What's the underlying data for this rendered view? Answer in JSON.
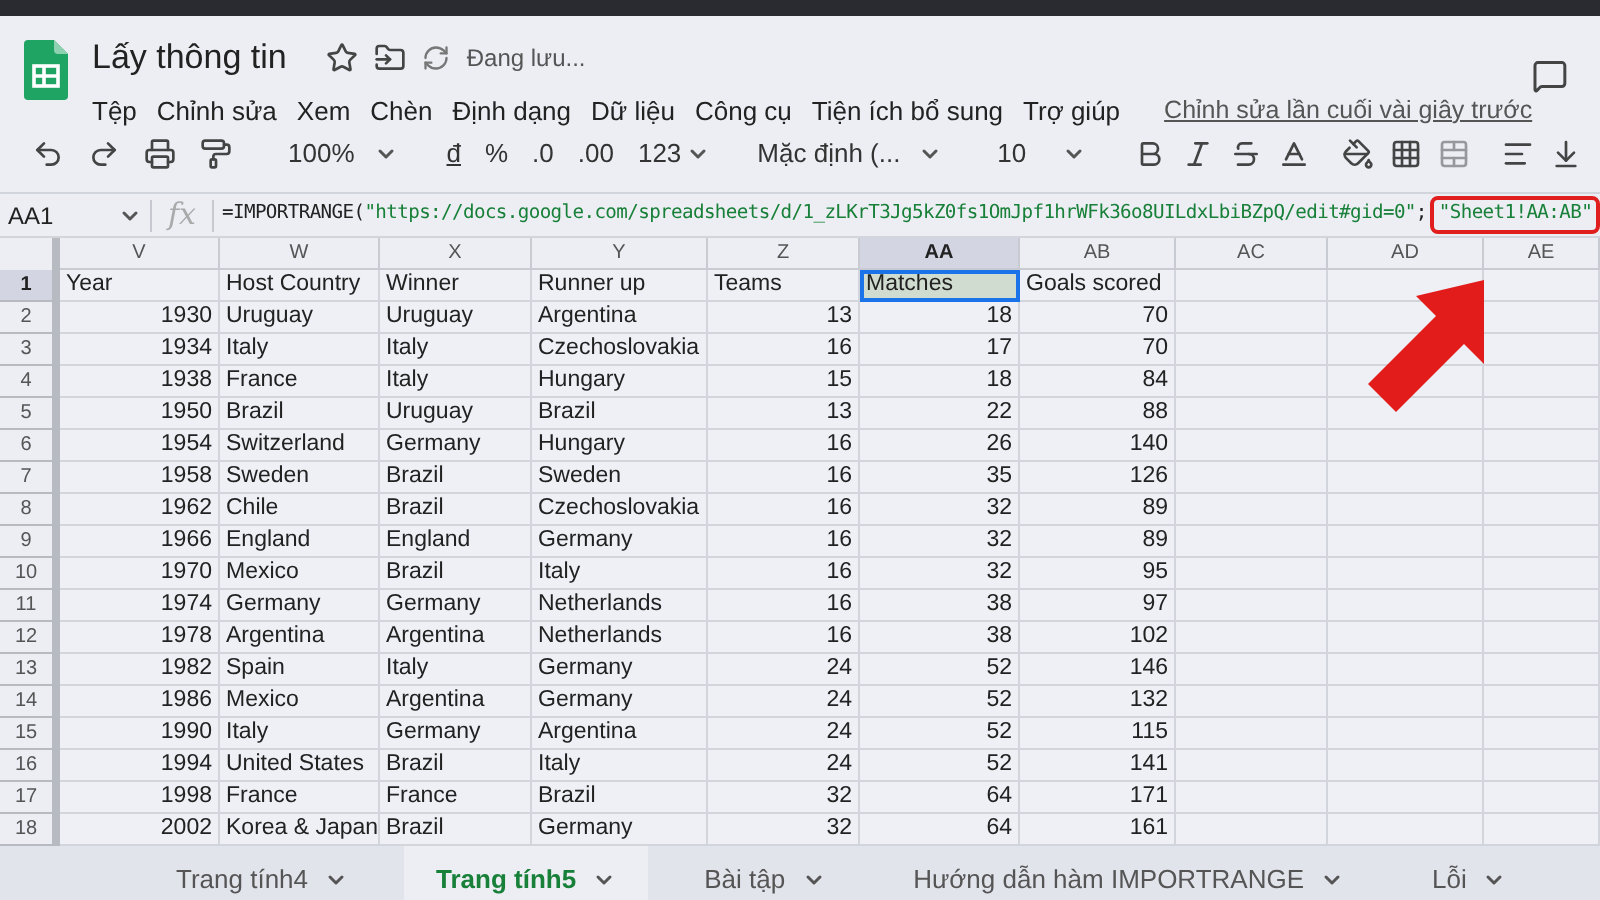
{
  "app": {
    "title": "Lấy thông tin",
    "status": "Đang lưu...",
    "menu": [
      "Tệp",
      "Chỉnh sửa",
      "Xem",
      "Chèn",
      "Định dạng",
      "Dữ liệu",
      "Công cụ",
      "Tiện ích bổ sung",
      "Trợ giúp"
    ],
    "last_edit": "Chỉnh sửa lần cuối vài giây trước"
  },
  "toolbar": {
    "zoom": "100%",
    "currency": "đ",
    "percent": "%",
    "decimal_less": ".0",
    "decimal_more": ".00",
    "number_format": "123",
    "font": "Mặc định (...",
    "font_size": "10"
  },
  "formula_bar": {
    "cell_ref": "AA1",
    "fx": "fx",
    "function": "=IMPORTRANGE(",
    "url": "\"https://docs.google.com/spreadsheets/d/1_zLKrT3Jg5kZ0fs1OmJpf1hrWFk36o8UILdxLbiBZpQ/edit#gid=0\"",
    "separator": ";",
    "range": "\"Sheet1!AA:AB\"",
    "range_highlighted": true
  },
  "columns": [
    {
      "label": "V",
      "selected": false
    },
    {
      "label": "W",
      "selected": false
    },
    {
      "label": "X",
      "selected": false
    },
    {
      "label": "Y",
      "selected": false
    },
    {
      "label": "Z",
      "selected": false
    },
    {
      "label": "AA",
      "selected": true
    },
    {
      "label": "AB",
      "selected": false
    },
    {
      "label": "AC",
      "selected": false
    },
    {
      "label": "AD",
      "selected": false
    },
    {
      "label": "AE",
      "selected": false
    }
  ],
  "rows": [
    {
      "number": "1",
      "cells": [
        "Year",
        "Host Country",
        "Winner",
        "Runner up",
        "Teams",
        "Matches",
        "Goals scored"
      ],
      "selected": true
    },
    {
      "number": "2",
      "cells": [
        "1930",
        "Uruguay",
        "Uruguay",
        "Argentina",
        "13",
        "18",
        "70"
      ],
      "selected": false
    },
    {
      "number": "3",
      "cells": [
        "1934",
        "Italy",
        "Italy",
        "Czechoslovakia",
        "16",
        "17",
        "70"
      ],
      "selected": false
    },
    {
      "number": "4",
      "cells": [
        "1938",
        "France",
        "Italy",
        "Hungary",
        "15",
        "18",
        "84"
      ],
      "selected": false
    },
    {
      "number": "5",
      "cells": [
        "1950",
        "Brazil",
        "Uruguay",
        "Brazil",
        "13",
        "22",
        "88"
      ],
      "selected": false
    },
    {
      "number": "6",
      "cells": [
        "1954",
        "Switzerland",
        "Germany",
        "Hungary",
        "16",
        "26",
        "140"
      ],
      "selected": false
    },
    {
      "number": "7",
      "cells": [
        "1958",
        "Sweden",
        "Brazil",
        "Sweden",
        "16",
        "35",
        "126"
      ],
      "selected": false
    },
    {
      "number": "8",
      "cells": [
        "1962",
        "Chile",
        "Brazil",
        "Czechoslovakia",
        "16",
        "32",
        "89"
      ],
      "selected": false
    },
    {
      "number": "9",
      "cells": [
        "1966",
        "England",
        "England",
        "Germany",
        "16",
        "32",
        "89"
      ],
      "selected": false
    },
    {
      "number": "10",
      "cells": [
        "1970",
        "Mexico",
        "Brazil",
        "Italy",
        "16",
        "32",
        "95"
      ],
      "selected": false
    },
    {
      "number": "11",
      "cells": [
        "1974",
        "Germany",
        "Germany",
        "Netherlands",
        "16",
        "38",
        "97"
      ],
      "selected": false
    },
    {
      "number": "12",
      "cells": [
        "1978",
        "Argentina",
        "Argentina",
        "Netherlands",
        "16",
        "38",
        "102"
      ],
      "selected": false
    },
    {
      "number": "13",
      "cells": [
        "1982",
        "Spain",
        "Italy",
        "Germany",
        "24",
        "52",
        "146"
      ],
      "selected": false
    },
    {
      "number": "14",
      "cells": [
        "1986",
        "Mexico",
        "Argentina",
        "Germany",
        "24",
        "52",
        "132"
      ],
      "selected": false
    },
    {
      "number": "15",
      "cells": [
        "1990",
        "Italy",
        "Germany",
        "Argentina",
        "24",
        "52",
        "115"
      ],
      "selected": false
    },
    {
      "number": "16",
      "cells": [
        "1994",
        "United States",
        "Brazil",
        "Italy",
        "24",
        "52",
        "141"
      ],
      "selected": false
    },
    {
      "number": "17",
      "cells": [
        "1998",
        "France",
        "France",
        "Brazil",
        "32",
        "64",
        "171"
      ],
      "selected": false
    },
    {
      "number": "18",
      "cells": [
        "2002",
        "Korea & Japan",
        "Brazil",
        "Germany",
        "32",
        "64",
        "161"
      ],
      "selected": false
    }
  ],
  "sheets": [
    {
      "label": "Trang tính4",
      "selected": false
    },
    {
      "label": "Trang tính5",
      "selected": true
    },
    {
      "label": "Bài tập",
      "selected": false
    },
    {
      "label": "Hướng dẫn hàm IMPORTRANGE",
      "selected": false
    },
    {
      "label": "Lỗi",
      "selected": false
    }
  ]
}
